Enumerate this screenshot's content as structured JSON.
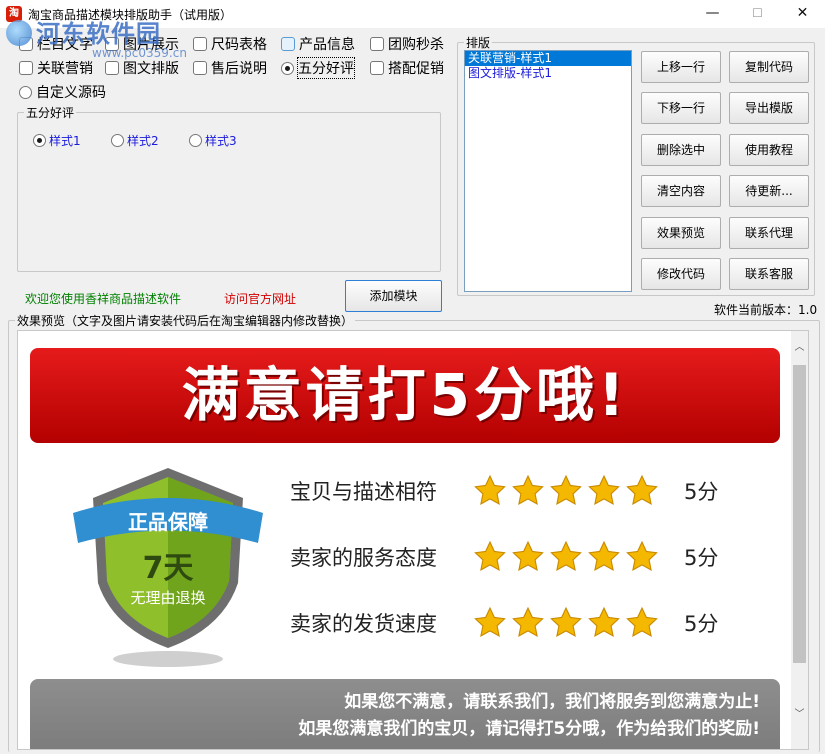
{
  "window": {
    "title": "淘宝商品描述模块排版助手（试用版）",
    "app_icon_text": "淘",
    "watermark_main": "河东软件园",
    "watermark_sub": "www.pc0359.cn",
    "min_glyph": "—",
    "max_glyph": "☐",
    "close_glyph": "✕"
  },
  "modules": {
    "row1": [
      "栏目文字",
      "图片展示",
      "尺码表格",
      "产品信息",
      "团购秒杀"
    ],
    "row2": [
      "关联营销",
      "图文排版",
      "售后说明",
      "五分好评",
      "搭配促销"
    ],
    "row3": [
      "自定义源码"
    ],
    "selected": "五分好评"
  },
  "style_group": {
    "label": "五分好评",
    "options": [
      "样式1",
      "样式2",
      "样式3"
    ],
    "selected": "样式1"
  },
  "layout_group": {
    "label": "排版",
    "list_items": [
      "关联营销-样式1",
      "图文排版-样式1"
    ],
    "selected_index": 0
  },
  "buttons": {
    "move_up": "上移一行",
    "copy_code": "复制代码",
    "move_down": "下移一行",
    "export_template": "导出模版",
    "delete_selected": "删除选中",
    "tutorial": "使用教程",
    "clear_content": "清空内容",
    "pending_update": "待更新...",
    "preview_effect": "效果预览",
    "contact_agent": "联系代理",
    "edit_code": "修改代码",
    "contact_support": "联系客服",
    "add_module": "添加模块"
  },
  "links": {
    "welcome": "欢迎您使用香祥商品描述软件",
    "official_site": "访问官方网址"
  },
  "version_text": "软件当前版本：1.0",
  "preview": {
    "label": "效果预览（文字及图片请安装代码后在淘宝编辑器内修改替换）",
    "banner_text": "满意请打5分哦!",
    "shield_top": "正品保障",
    "shield_days": "7天",
    "shield_sub": "无理由退换",
    "ratings": [
      {
        "label": "宝贝与描述相符",
        "stars": 5,
        "score": "5分"
      },
      {
        "label": "卖家的服务态度",
        "stars": 5,
        "score": "5分"
      },
      {
        "label": "卖家的发货速度",
        "stars": 5,
        "score": "5分"
      }
    ],
    "footer_lines": [
      "如果您不满意，请联系我们，我们将服务到您满意为止!",
      "如果您满意我们的宝贝，请记得打5分哦，作为给我们的奖励!"
    ]
  },
  "colors": {
    "banner_red": "#d40000",
    "link_green": "#008000",
    "link_red": "#d00000",
    "list_selected": "#0078d7",
    "star_gold": "#f5b800"
  }
}
